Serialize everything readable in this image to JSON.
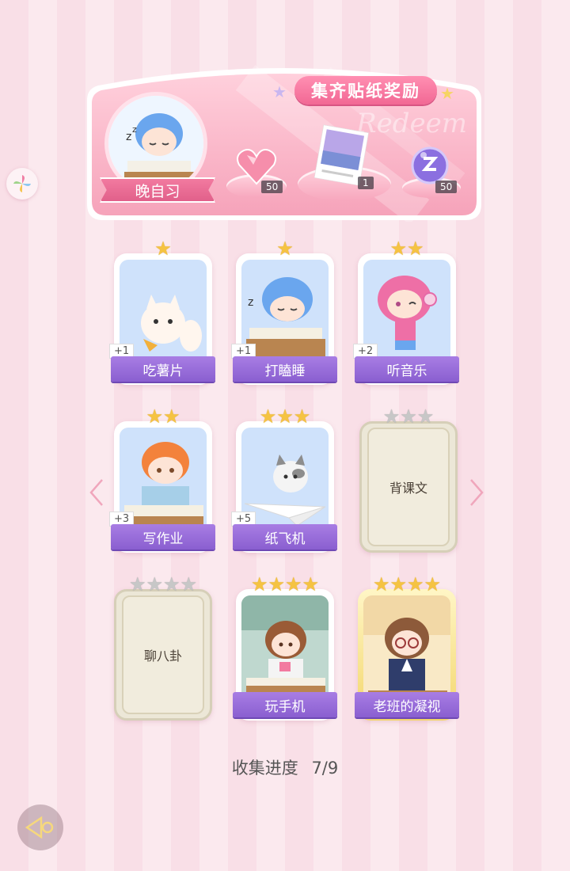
{
  "reward_panel": {
    "title": "集齐贴纸奖励",
    "watermark": "Redeem",
    "session_label": "晚自习",
    "rewards": [
      {
        "icon": "heart-gem-icon",
        "count": "50"
      },
      {
        "icon": "photo-card-icon",
        "count": "1"
      },
      {
        "icon": "purple-orb-icon",
        "count": "50"
      }
    ]
  },
  "stickers": [
    {
      "label": "吃薯片",
      "stars_gold": 1,
      "stars_total": 1,
      "bonus": "+1",
      "unlocked": true
    },
    {
      "label": "打瞌睡",
      "stars_gold": 1,
      "stars_total": 1,
      "bonus": "+1",
      "unlocked": true
    },
    {
      "label": "听音乐",
      "stars_gold": 2,
      "stars_total": 2,
      "bonus": "+2",
      "unlocked": true
    },
    {
      "label": "写作业",
      "stars_gold": 2,
      "stars_total": 2,
      "bonus": "+3",
      "unlocked": true
    },
    {
      "label": "纸飞机",
      "stars_gold": 3,
      "stars_total": 3,
      "bonus": "+5",
      "unlocked": true
    },
    {
      "label": "背课文",
      "stars_gold": 0,
      "stars_total": 3,
      "bonus": "",
      "unlocked": false
    },
    {
      "label": "聊八卦",
      "stars_gold": 0,
      "stars_total": 4,
      "bonus": "",
      "unlocked": false
    },
    {
      "label": "玩手机",
      "stars_gold": 4,
      "stars_total": 4,
      "bonus": "",
      "unlocked": true
    },
    {
      "label": "老班的凝视",
      "stars_gold": 4,
      "stars_total": 4,
      "bonus": "",
      "unlocked": true
    }
  ],
  "progress": {
    "label": "收集进度",
    "value": "7/9",
    "collected": 7,
    "total": 9
  },
  "nav": {
    "prev_icon": "chevron-left-icon",
    "next_icon": "chevron-right-icon",
    "back_icon": "back-arrow-icon"
  }
}
